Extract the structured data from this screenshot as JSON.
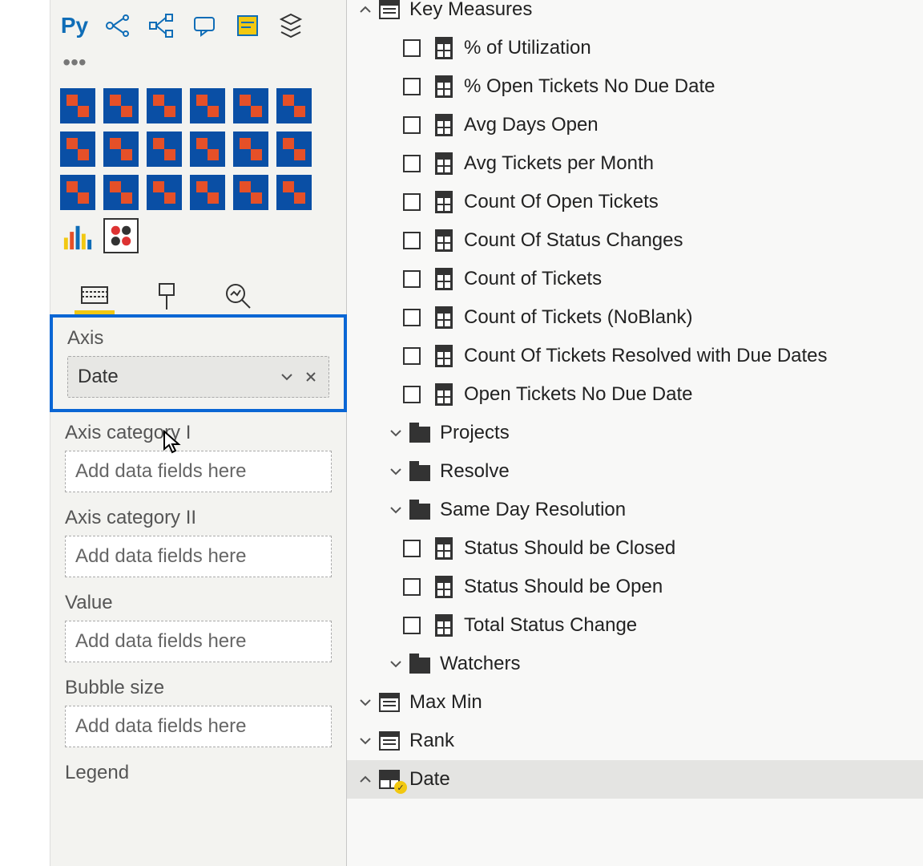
{
  "viz_top_icons_row2": [
    "Py"
  ],
  "wells": {
    "axis": {
      "label": "Axis",
      "field": "Date"
    },
    "axis_cat1": {
      "label": "Axis category I",
      "placeholder": "Add data fields here"
    },
    "axis_cat2": {
      "label": "Axis category II",
      "placeholder": "Add data fields here"
    },
    "value": {
      "label": "Value",
      "placeholder": "Add data fields here"
    },
    "bubble": {
      "label": "Bubble size",
      "placeholder": "Add data fields here"
    },
    "legend_partial": "Legend"
  },
  "fields": {
    "tables": {
      "key_measures": {
        "name": "Key Measures",
        "measures": [
          "% of Utilization",
          "% Open Tickets No Due Date",
          "Avg Days Open",
          "Avg Tickets per Month",
          "Count Of Open Tickets",
          "Count Of Status Changes",
          "Count of Tickets",
          "Count of Tickets (NoBlank)",
          "Count Of Tickets Resolved with Due Dates",
          "Open Tickets No Due Date"
        ],
        "folders": [
          "Projects",
          "Resolve",
          "Same Day Resolution"
        ],
        "measures2": [
          "Status Should be Closed",
          "Status Should be Open",
          "Total Status Change"
        ],
        "folders2": [
          "Watchers"
        ]
      },
      "max_min": {
        "name": "Max Min"
      },
      "rank": {
        "name": "Rank"
      },
      "date": {
        "name": "Date"
      }
    }
  }
}
